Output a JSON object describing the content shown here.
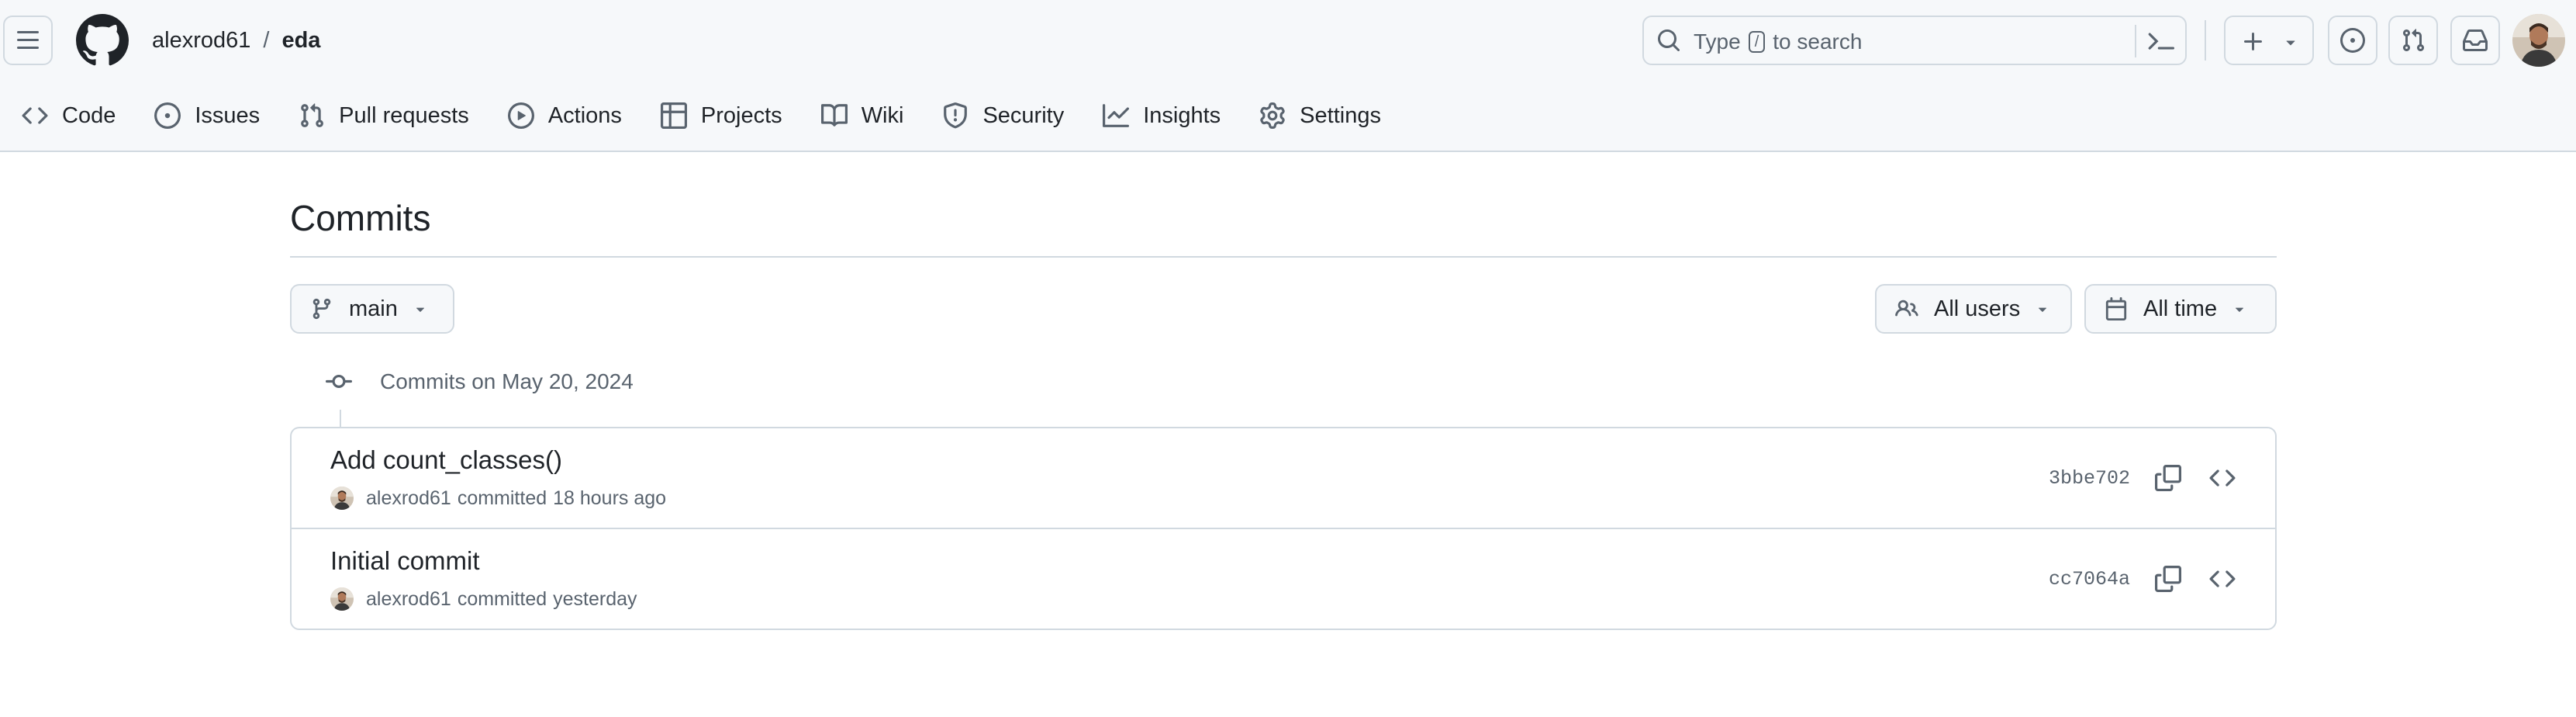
{
  "colors": {
    "header_bg": "#f6f8fa",
    "border": "#d1d9e0",
    "text": "#1f2328",
    "muted": "#59636e"
  },
  "header": {
    "owner": "alexrod61",
    "separator": "/",
    "repo": "eda",
    "search": {
      "prefix": "Type",
      "kbd": "/",
      "suffix": "to search"
    },
    "icons": [
      "menu-icon",
      "github-logo-icon",
      "search-icon",
      "command-palette-icon",
      "plus-icon",
      "triangle-down-icon",
      "issue-opened-icon",
      "git-pull-request-icon",
      "inbox-icon"
    ]
  },
  "repo_nav": {
    "items": [
      {
        "label": "Code",
        "icon": "code-icon"
      },
      {
        "label": "Issues",
        "icon": "issue-opened-icon"
      },
      {
        "label": "Pull requests",
        "icon": "git-pull-request-icon"
      },
      {
        "label": "Actions",
        "icon": "play-icon"
      },
      {
        "label": "Projects",
        "icon": "table-icon"
      },
      {
        "label": "Wiki",
        "icon": "book-icon"
      },
      {
        "label": "Security",
        "icon": "shield-icon"
      },
      {
        "label": "Insights",
        "icon": "graph-icon"
      },
      {
        "label": "Settings",
        "icon": "gear-icon"
      }
    ]
  },
  "page": {
    "title": "Commits",
    "branch": "main",
    "users_filter": "All users",
    "time_filter": "All time",
    "group_label": "Commits on May 20, 2024"
  },
  "commits": [
    {
      "message": "Add count_classes()",
      "author": "alexrod61",
      "action": "committed",
      "time": "18 hours ago",
      "sha": "3bbe702"
    },
    {
      "message": "Initial commit",
      "author": "alexrod61",
      "action": "committed",
      "time": "yesterday",
      "sha": "cc7064a"
    }
  ]
}
